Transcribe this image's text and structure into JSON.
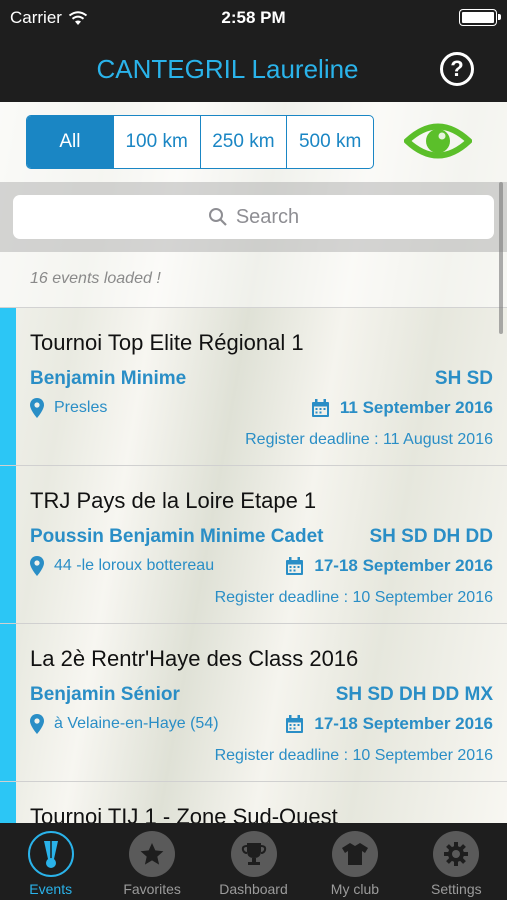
{
  "status": {
    "carrier": "Carrier",
    "time": "2:58 PM"
  },
  "header": {
    "title": "CANTEGRIL Laureline",
    "help_icon": "question-circle-icon"
  },
  "filters": {
    "options": [
      "All",
      "100 km",
      "250 km",
      "500 km"
    ],
    "selected": "All",
    "eye_icon": "eye-icon",
    "eye_color": "#5bbf2a"
  },
  "search": {
    "placeholder": "Search"
  },
  "loaded_message": "16 events loaded !",
  "events": [
    {
      "title": "Tournoi Top Elite Régional 1",
      "categories": "Benjamin Minime",
      "disciplines": "SH SD",
      "location": "Presles",
      "date": "11 September 2016",
      "deadline": "Register deadline : 11 August 2016"
    },
    {
      "title": "TRJ Pays de la Loire Etape 1",
      "categories": "Poussin Benjamin Minime Cadet",
      "disciplines": "SH SD DH DD",
      "location": "44 -le loroux bottereau",
      "date": "17-18 September 2016",
      "deadline": "Register deadline : 10 September 2016"
    },
    {
      "title": "La 2è Rentr'Haye des Class 2016",
      "categories": "Benjamin Sénior",
      "disciplines": "SH SD DH DD MX",
      "location": "à Velaine-en-Haye (54)",
      "date": "17-18 September 2016",
      "deadline": "Register deadline : 10 September 2016"
    },
    {
      "title": "Tournoi TIJ 1 - Zone Sud-Ouest",
      "categories": "",
      "disciplines": "",
      "location": "",
      "date": "",
      "deadline": ""
    }
  ],
  "tabs": [
    {
      "label": "Events",
      "icon": "shuttlecock-icon",
      "active": true
    },
    {
      "label": "Favorites",
      "icon": "star-icon",
      "active": false
    },
    {
      "label": "Dashboard",
      "icon": "trophy-icon",
      "active": false
    },
    {
      "label": "My club",
      "icon": "shirt-icon",
      "active": false
    },
    {
      "label": "Settings",
      "icon": "gear-icon",
      "active": false
    }
  ],
  "colors": {
    "accent": "#2ab3ea",
    "link": "#2a8ec6",
    "segment": "#1a86c4",
    "stripe": "#2cc6f5"
  }
}
